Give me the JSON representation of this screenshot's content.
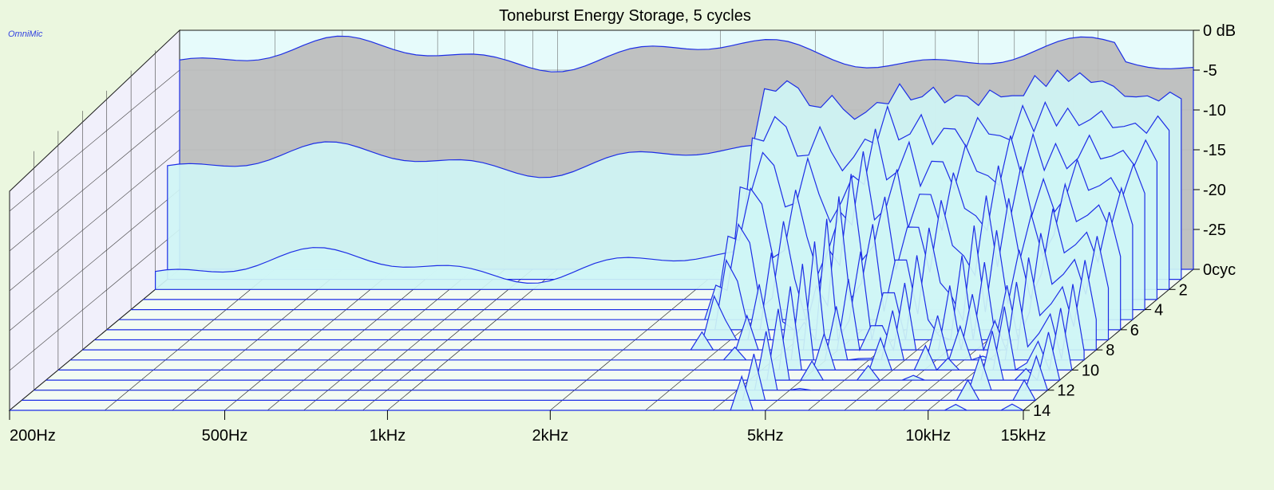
{
  "chart_data": {
    "type": "waterfall",
    "title": "Toneburst Energy Storage, 5 cycles",
    "watermark": "OmniMic",
    "x_axis": {
      "scale": "log",
      "range_hz": [
        200,
        15000
      ],
      "tick_labels": [
        "200Hz",
        "500Hz",
        "1kHz",
        "2kHz",
        "5kHz",
        "10kHz",
        "15kHz"
      ]
    },
    "y_axis": {
      "unit": "dB",
      "range": [
        -30,
        0
      ],
      "tick_labels": [
        "0 dB",
        "-5",
        "-10",
        "-15",
        "-20",
        "-25"
      ]
    },
    "z_axis": {
      "unit": "cycles",
      "range": [
        0,
        14
      ],
      "tick_labels": [
        "0cyc",
        "2",
        "4",
        "6",
        "8",
        "10",
        "12",
        "14"
      ]
    },
    "colors": {
      "background": "#ebf7df",
      "back_wall": "#e6fbfb",
      "side_wall": "#f1f0fb",
      "floor": "#f3fbf3",
      "grid": "#1a1a1a",
      "slice_fill_front": "#cff5f5",
      "slice_fill_back": "#bcbcbc",
      "slice_outline": "#1d2ee6",
      "watermark": "#2f3fe0"
    },
    "series_description": "Decay slices from 0 to 14 cycles; energy stays near -2 to -8 dB below ~3 kHz, with visible storage ridges between 3 kHz and 15 kHz"
  }
}
